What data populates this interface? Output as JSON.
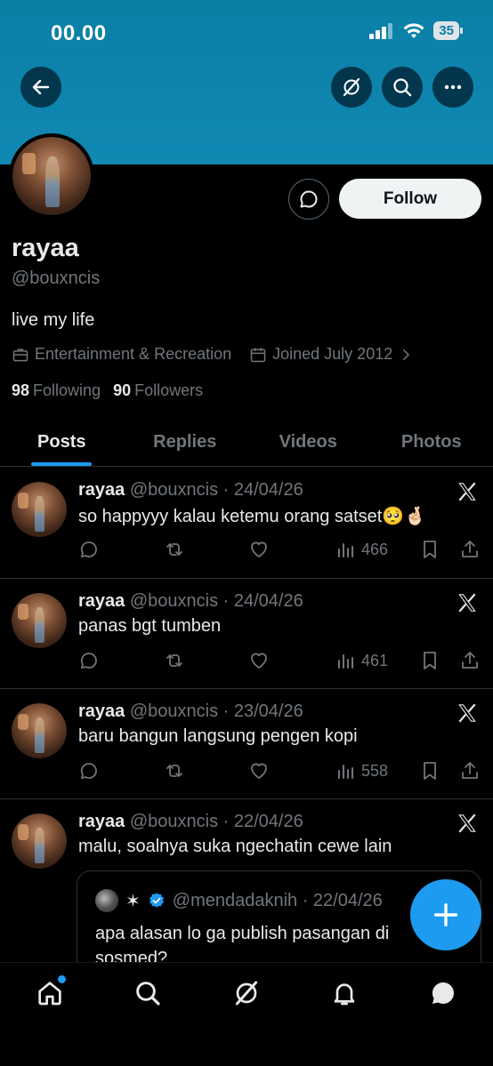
{
  "status_bar": {
    "time": "00.00",
    "battery": "35"
  },
  "profile": {
    "display_name": "rayaa",
    "handle": "@bouxncis",
    "bio": "live my life",
    "category": "Entertainment & Recreation",
    "joined": "Joined July 2012",
    "following_count": "98",
    "following_label": "Following",
    "followers_count": "90",
    "followers_label": "Followers",
    "follow_label": "Follow"
  },
  "tabs": [
    {
      "label": "Posts",
      "active": true
    },
    {
      "label": "Replies"
    },
    {
      "label": "Videos"
    },
    {
      "label": "Photos"
    }
  ],
  "posts": [
    {
      "name": "rayaa",
      "handle_date": "@bouxncis · 24/04/26",
      "text": "so happyyy kalau ketemu orang satset🥺🤞🏻",
      "views": "466"
    },
    {
      "name": "rayaa",
      "handle_date": "@bouxncis · 24/04/26",
      "text": "panas bgt tumben",
      "views": "461"
    },
    {
      "name": "rayaa",
      "handle_date": "@bouxncis · 23/04/26",
      "text": "baru bangun langsung pengen kopi",
      "views": "558"
    },
    {
      "name": "rayaa",
      "handle_date": "@bouxncis · 22/04/26",
      "text": "malu, soalnya suka ngechatin cewe lain"
    }
  ],
  "quote": {
    "star": "✶",
    "handle_date": "@mendadaknih · 22/04/26",
    "text": "apa alasan lo ga publish pasangan di sosmed?"
  },
  "colors": {
    "accent": "#1d9bf0",
    "banner": "#0a7fa6",
    "muted": "#71767b",
    "border": "#2f3336"
  },
  "icons": {
    "top": [
      "back-arrow-icon",
      "grok-icon",
      "search-icon",
      "more-icon"
    ],
    "nav": [
      "home-icon",
      "search-icon",
      "grok-icon",
      "bell-icon",
      "messages-icon"
    ]
  }
}
